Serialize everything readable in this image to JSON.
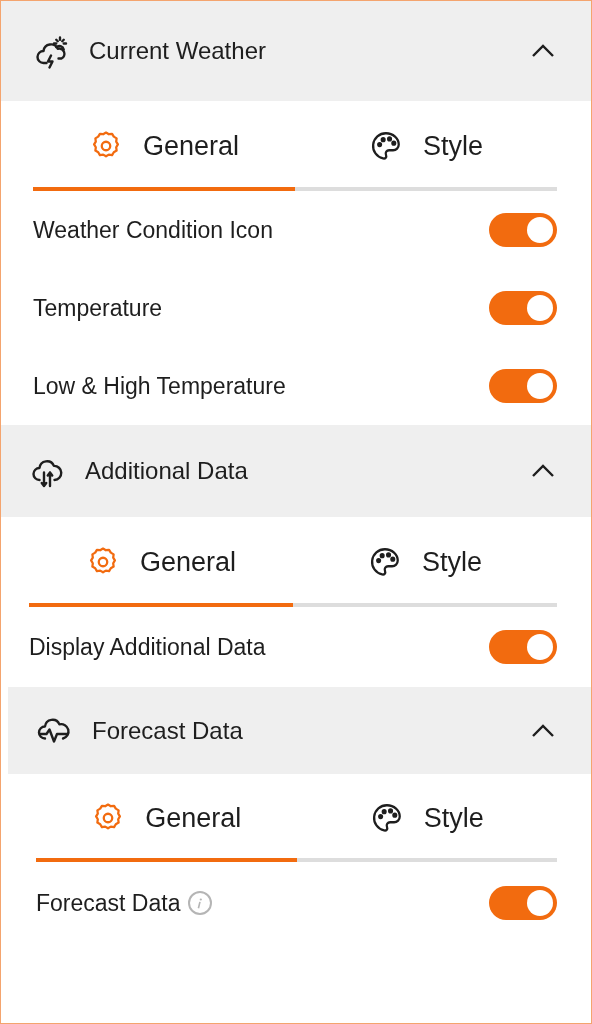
{
  "sections": [
    {
      "title": "Current Weather",
      "expanded": true,
      "tabs": [
        {
          "label": "General",
          "selected": true
        },
        {
          "label": "Style",
          "selected": false
        }
      ],
      "settings": [
        {
          "label": "Weather Condition Icon",
          "on": true
        },
        {
          "label": "Temperature",
          "on": true
        },
        {
          "label": "Low & High Temperature",
          "on": true
        }
      ]
    },
    {
      "title": "Additional Data",
      "expanded": true,
      "tabs": [
        {
          "label": "General",
          "selected": true
        },
        {
          "label": "Style",
          "selected": false
        }
      ],
      "settings": [
        {
          "label": "Display Additional Data",
          "on": true
        }
      ]
    },
    {
      "title": "Forecast Data",
      "expanded": true,
      "tabs": [
        {
          "label": "General",
          "selected": true
        },
        {
          "label": "Style",
          "selected": false
        }
      ],
      "settings": [
        {
          "label": "Forecast Data",
          "info": true,
          "on": true
        }
      ]
    }
  ]
}
